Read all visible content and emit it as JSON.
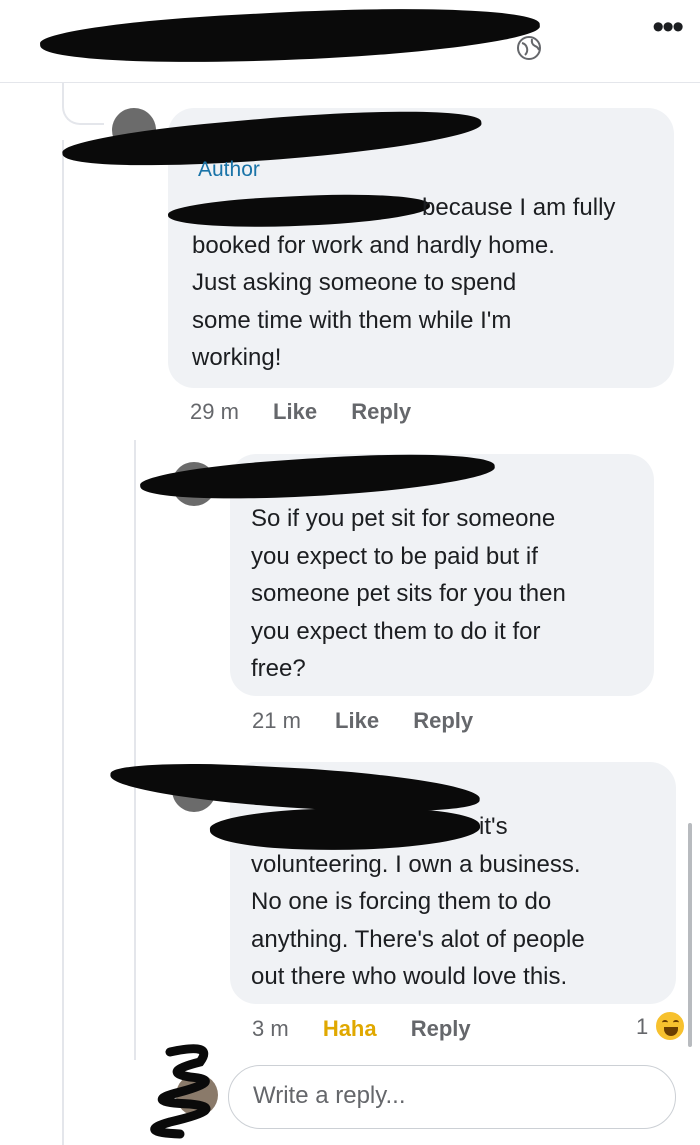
{
  "header": {
    "more_icon": "more-horizontal-icon",
    "privacy_icon": "globe-icon"
  },
  "comments": [
    {
      "author_badge": "Author",
      "text": "because I am fully\nbooked for work and hardly home.\nJust asking someone to spend\nsome time with them while I'm\nworking!",
      "time": "29 m",
      "like_label": "Like",
      "reply_label": "Reply"
    },
    {
      "text": "So if you pet sit for someone\nyou expect to be paid but if\nsomeone pet sits for you then\nyou expect them to do it for\nfree?",
      "time": "21 m",
      "like_label": "Like",
      "reply_label": "Reply"
    },
    {
      "text": "it's\nvolunteering. I own a business.\nNo one is forcing them to do\nanything. There's alot of people\nout there who would love this.",
      "time": "3 m",
      "reaction_label": "Haha",
      "reply_label": "Reply",
      "reaction_count": "1",
      "reaction_icon": "haha-emoji-icon",
      "reaction_color": "#e0a800"
    }
  ],
  "composer": {
    "placeholder": "Write a reply..."
  }
}
